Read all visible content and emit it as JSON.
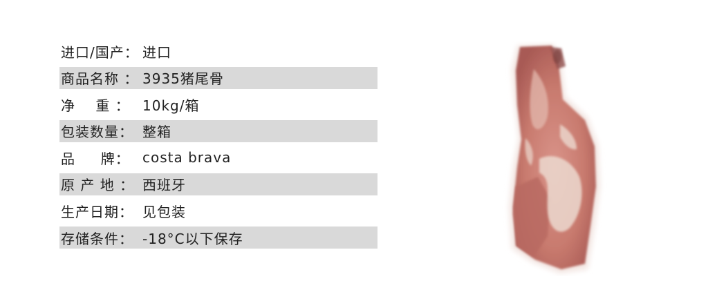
{
  "specs": [
    {
      "label": "进口/国产：",
      "value": "进口",
      "shaded": false
    },
    {
      "label": "商品名称 ：",
      "value": "3935猪尾骨",
      "shaded": true
    },
    {
      "label": "净    重 ：",
      "value": "10kg/箱",
      "shaded": false
    },
    {
      "label": "包装数量：",
      "value": "整箱",
      "shaded": true
    },
    {
      "label": "品     牌：",
      "value": "costa brava",
      "shaded": false
    },
    {
      "label": "原 产 地 ：",
      "value": "西班牙",
      "shaded": true
    },
    {
      "label": "生产日期：",
      "value": "见包装",
      "shaded": false
    },
    {
      "label": "存储条件：",
      "value": "-18°C以下保存",
      "shaded": true
    }
  ],
  "photo": {
    "subject": "pork-tail-bone",
    "colors": {
      "meat": "#c87a6e",
      "meat_dark": "#a85a55",
      "fat": "#ecd9cf"
    }
  }
}
